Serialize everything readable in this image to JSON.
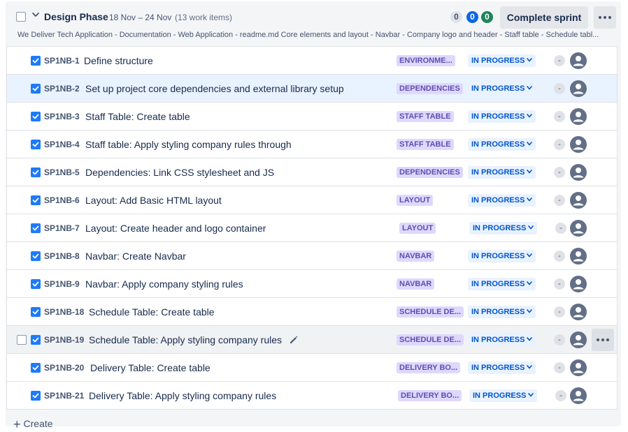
{
  "sprint": {
    "name": "Design Phase",
    "dates": "18 Nov – 24 Nov",
    "count": "(13 work items)",
    "counts": {
      "todo": "0",
      "in_progress": "0",
      "done": "0"
    },
    "complete_label": "Complete sprint",
    "goal": "We Deliver Tech Application - Documentation - Web Application - readme.md Core elements and layout - Navbar - Company logo and header - Staff table - Schedule tabl..."
  },
  "issues": [
    {
      "key": "SP1NB-1",
      "summary": "Define structure",
      "epic": "ENVIRONME...",
      "status": "IN PROGRESS",
      "estimate": "-"
    },
    {
      "key": "SP1NB-2",
      "summary": "Set up project core dependencies and external library setup",
      "epic": "DEPENDENCIES",
      "status": "IN PROGRESS",
      "estimate": "-"
    },
    {
      "key": "SP1NB-3",
      "summary": "Staff Table: Create table",
      "epic": "STAFF TABLE",
      "status": "IN PROGRESS",
      "estimate": "-"
    },
    {
      "key": "SP1NB-4",
      "summary": "Staff table: Apply styling company rules through",
      "epic": "STAFF TABLE",
      "status": "IN PROGRESS",
      "estimate": "-"
    },
    {
      "key": "SP1NB-5",
      "summary": "Dependencies: Link CSS stylesheet and JS",
      "epic": "DEPENDENCIES",
      "status": "IN PROGRESS",
      "estimate": "-"
    },
    {
      "key": "SP1NB-6",
      "summary": "Layout: Add Basic HTML layout",
      "epic": "LAYOUT",
      "status": "IN PROGRESS",
      "estimate": "-"
    },
    {
      "key": "SP1NB-7",
      "summary": "Layout: Create header and logo container",
      "epic": "LAYOUT",
      "status": "IN PROGRESS",
      "estimate": "-"
    },
    {
      "key": "SP1NB-8",
      "summary": "Navbar: Create Navbar",
      "epic": "NAVBAR",
      "status": "IN PROGRESS",
      "estimate": "-"
    },
    {
      "key": "SP1NB-9",
      "summary": "Navbar: Apply company styling rules",
      "epic": "NAVBAR",
      "status": "IN PROGRESS",
      "estimate": "-"
    },
    {
      "key": "SP1NB-18",
      "summary": "Schedule Table: Create table",
      "epic": "SCHEDULE DE...",
      "status": "IN PROGRESS",
      "estimate": "-"
    },
    {
      "key": "SP1NB-19",
      "summary": "Schedule Table: Apply styling company rules",
      "epic": "SCHEDULE DE...",
      "status": "IN PROGRESS",
      "estimate": "-"
    },
    {
      "key": "SP1NB-20",
      "summary": "Delivery Table: Create table",
      "epic": "DELIVERY BO...",
      "status": "IN PROGRESS",
      "estimate": "-"
    },
    {
      "key": "SP1NB-21",
      "summary": "Delivery Table: Apply styling company rules",
      "epic": "DELIVERY BO...",
      "status": "IN PROGRESS",
      "estimate": "-"
    }
  ],
  "create_label": "Create",
  "colors": {
    "accent": "#0c66e4",
    "done": "#1f845a",
    "epic_bg": "#dfd8fd",
    "epic_text": "#5e4db2",
    "status_text": "#0055cc"
  }
}
